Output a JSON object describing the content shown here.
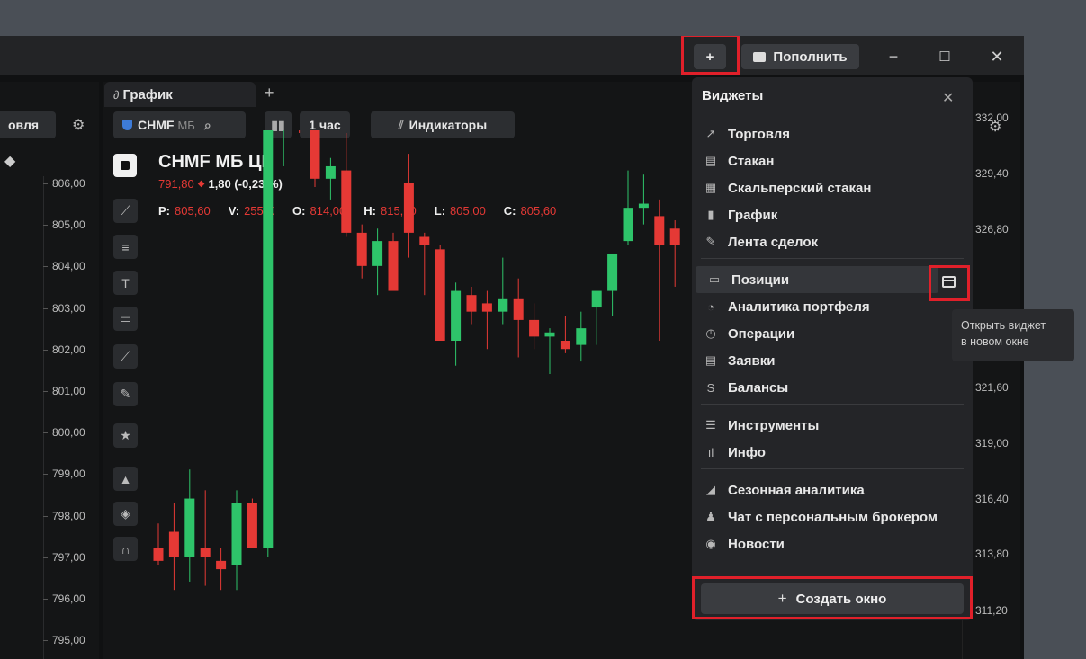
{
  "titlebar": {
    "add_label": "+",
    "topup_label": "Пополнить",
    "minimize": "−",
    "maximize": "☐",
    "close": "✕"
  },
  "left_panel": {
    "button_label": "овля",
    "y_ticks": [
      "806,00",
      "805,00",
      "804,00",
      "803,00",
      "802,00",
      "801,00",
      "800,00",
      "799,00",
      "798,00",
      "797,00",
      "796,00",
      "795,00"
    ]
  },
  "chart_tab": {
    "label": "График",
    "add_tab": "+"
  },
  "chart_toolbar": {
    "ticker": "CHMF",
    "board": "МБ",
    "interval": "1 час",
    "indicators": "Индикаторы"
  },
  "instrument": {
    "title": "CHMF МБ ЦК",
    "price": "791,80",
    "change": "1,80 (-0,23 %)",
    "ohlc": [
      {
        "key": "P:",
        "value": "805,60"
      },
      {
        "key": "V:",
        "value": "255 K"
      },
      {
        "key": "O:",
        "value": "814,00"
      },
      {
        "key": "H:",
        "value": "815,60"
      },
      {
        "key": "L:",
        "value": "805,00"
      },
      {
        "key": "C:",
        "value": "805,60"
      }
    ]
  },
  "right_axis": {
    "ticks": [
      "332,00",
      "329,40",
      "326,80",
      "321,60",
      "319,00",
      "316,40",
      "313,80",
      "311,20"
    ]
  },
  "widgets_popup": {
    "title": "Виджеты",
    "close": "✕",
    "groups": [
      [
        "Торговля",
        "Стакан",
        "Скальперский стакан",
        "График",
        "Лента сделок"
      ],
      [
        "Позиции",
        "Аналитика портфеля",
        "Операции",
        "Заявки",
        "Балансы"
      ],
      [
        "Инструменты",
        "Инфо"
      ],
      [
        "Сезонная аналитика",
        "Чат с персональным брокером",
        "Новости"
      ]
    ],
    "create_window": "Создать окно"
  },
  "tooltip": {
    "line1": "Открыть виджет",
    "line2": "в новом окне"
  },
  "colors": {
    "up": "#2ec46a",
    "down": "#e53935",
    "highlight": "#e0202a"
  },
  "chart_data": {
    "type": "candlestick",
    "series": [
      {
        "o": 796.0,
        "h": 796.6,
        "l": 795.6,
        "c": 795.7
      },
      {
        "o": 796.4,
        "h": 797.1,
        "l": 795.0,
        "c": 795.8
      },
      {
        "o": 795.8,
        "h": 797.9,
        "l": 795.2,
        "c": 797.2
      },
      {
        "o": 796.0,
        "h": 797.4,
        "l": 795.1,
        "c": 795.8
      },
      {
        "o": 795.7,
        "h": 796.0,
        "l": 795.0,
        "c": 795.5
      },
      {
        "o": 795.6,
        "h": 797.4,
        "l": 795.0,
        "c": 797.1
      },
      {
        "o": 797.1,
        "h": 797.2,
        "l": 796.0,
        "c": 796.0
      },
      {
        "o": 796.0,
        "h": 807.0,
        "l": 795.8,
        "c": 806.4
      },
      {
        "o": 806.4,
        "h": 807.2,
        "l": 805.2,
        "c": 806.6
      },
      {
        "o": 807.0,
        "h": 808.0,
        "l": 806.0,
        "c": 806.8
      },
      {
        "o": 806.6,
        "h": 806.8,
        "l": 804.7,
        "c": 804.9
      },
      {
        "o": 804.9,
        "h": 805.4,
        "l": 804.4,
        "c": 805.2
      },
      {
        "o": 805.1,
        "h": 806.0,
        "l": 803.5,
        "c": 803.6
      },
      {
        "o": 803.6,
        "h": 803.8,
        "l": 802.5,
        "c": 802.8
      },
      {
        "o": 802.8,
        "h": 803.7,
        "l": 802.1,
        "c": 803.4
      },
      {
        "o": 803.4,
        "h": 803.6,
        "l": 802.2,
        "c": 802.2
      },
      {
        "o": 804.8,
        "h": 805.5,
        "l": 803.0,
        "c": 803.6
      },
      {
        "o": 803.5,
        "h": 803.6,
        "l": 802.1,
        "c": 803.3
      },
      {
        "o": 803.2,
        "h": 803.3,
        "l": 801.0,
        "c": 801.0
      },
      {
        "o": 801.0,
        "h": 802.4,
        "l": 800.4,
        "c": 802.2
      },
      {
        "o": 802.1,
        "h": 802.3,
        "l": 801.4,
        "c": 801.7
      },
      {
        "o": 801.9,
        "h": 802.2,
        "l": 800.8,
        "c": 801.7
      },
      {
        "o": 801.7,
        "h": 803.0,
        "l": 801.4,
        "c": 802.0
      },
      {
        "o": 802.0,
        "h": 802.5,
        "l": 800.6,
        "c": 801.5
      },
      {
        "o": 801.5,
        "h": 801.9,
        "l": 800.8,
        "c": 801.1
      },
      {
        "o": 801.1,
        "h": 801.3,
        "l": 800.2,
        "c": 801.2
      },
      {
        "o": 801.0,
        "h": 801.6,
        "l": 800.7,
        "c": 800.8
      },
      {
        "o": 800.9,
        "h": 801.7,
        "l": 800.5,
        "c": 801.3
      },
      {
        "o": 801.8,
        "h": 801.9,
        "l": 800.9,
        "c": 802.2
      },
      {
        "o": 802.2,
        "h": 803.0,
        "l": 801.6,
        "c": 803.1
      },
      {
        "o": 803.4,
        "h": 805.1,
        "l": 803.3,
        "c": 804.2
      },
      {
        "o": 804.2,
        "h": 805.0,
        "l": 803.8,
        "c": 804.3
      },
      {
        "o": 804.0,
        "h": 804.4,
        "l": 801.0,
        "c": 803.3
      },
      {
        "o": 803.7,
        "h": 803.9,
        "l": 802.3,
        "c": 803.3
      }
    ]
  }
}
